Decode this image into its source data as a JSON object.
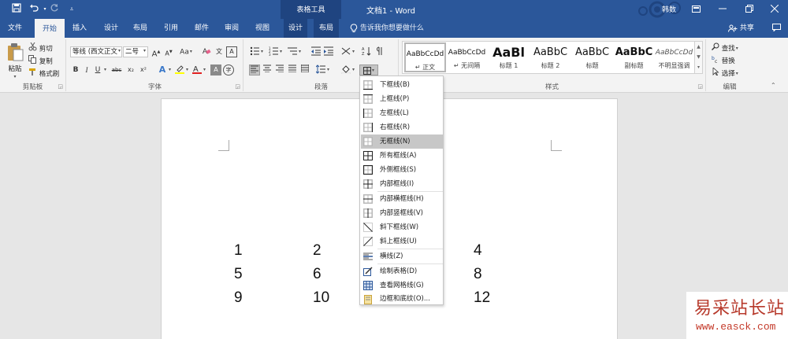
{
  "titlebar": {
    "doc_title": "文档1  -  Word",
    "context_tab": "表格工具",
    "user": "韩数"
  },
  "tabs": [
    "文件",
    "开始",
    "插入",
    "设计",
    "布局",
    "引用",
    "邮件",
    "审阅",
    "视图",
    "设计",
    "布局"
  ],
  "active_tab": "开始",
  "tell_me": "告诉我你想要做什么",
  "share": "共享",
  "clipboard": {
    "paste": "粘贴",
    "cut": "剪切",
    "copy": "复制",
    "format_painter": "格式刷",
    "label": "剪贴板"
  },
  "font": {
    "font_name": "等线 (西文正文",
    "font_size": "二号",
    "bold": "B",
    "italic": "I",
    "underline": "U",
    "strike": "abc",
    "subscript": "x₂",
    "superscript": "x²",
    "grow": "A",
    "shrink": "A",
    "case": "Aa",
    "phonetic": "文",
    "enclose": "A",
    "label": "字体"
  },
  "paragraph": {
    "label": "段落"
  },
  "styles": {
    "label": "样式",
    "items": [
      {
        "sample": "AaBbCcDd",
        "name": "↵ 正文"
      },
      {
        "sample": "AaBbCcDd",
        "name": "↵ 无间隔"
      },
      {
        "sample": "AaBl",
        "name": "标题 1"
      },
      {
        "sample": "AaBbC",
        "name": "标题 2"
      },
      {
        "sample": "AaBbC",
        "name": "标题"
      },
      {
        "sample": "AaBbC",
        "name": "副标题"
      },
      {
        "sample": "AaBbCcDd",
        "name": "不明显强调"
      }
    ]
  },
  "editing": {
    "find": "查找",
    "replace": "替换",
    "select": "选择",
    "label": "编辑"
  },
  "table_cells": [
    "1",
    "2",
    "4",
    "5",
    "6",
    "8",
    "9",
    "10",
    "12"
  ],
  "border_menu": {
    "items": [
      "下框线(B)",
      "上框线(P)",
      "左框线(L)",
      "右框线(R)",
      "无框线(N)",
      "所有框线(A)",
      "外侧框线(S)",
      "内部框线(I)",
      "内部横框线(H)",
      "内部竖框线(V)",
      "斜下框线(W)",
      "斜上框线(U)",
      "横线(Z)",
      "绘制表格(D)",
      "查看网格线(G)",
      "边框和底纹(O)..."
    ],
    "highlighted": "无框线(N)"
  },
  "watermark": {
    "title": "易采站长站",
    "url": "www.easck.com"
  },
  "colors": {
    "titlebar": "#2b579a",
    "ribbon": "#f3f3f3",
    "highlight": "#c7c7c7"
  }
}
